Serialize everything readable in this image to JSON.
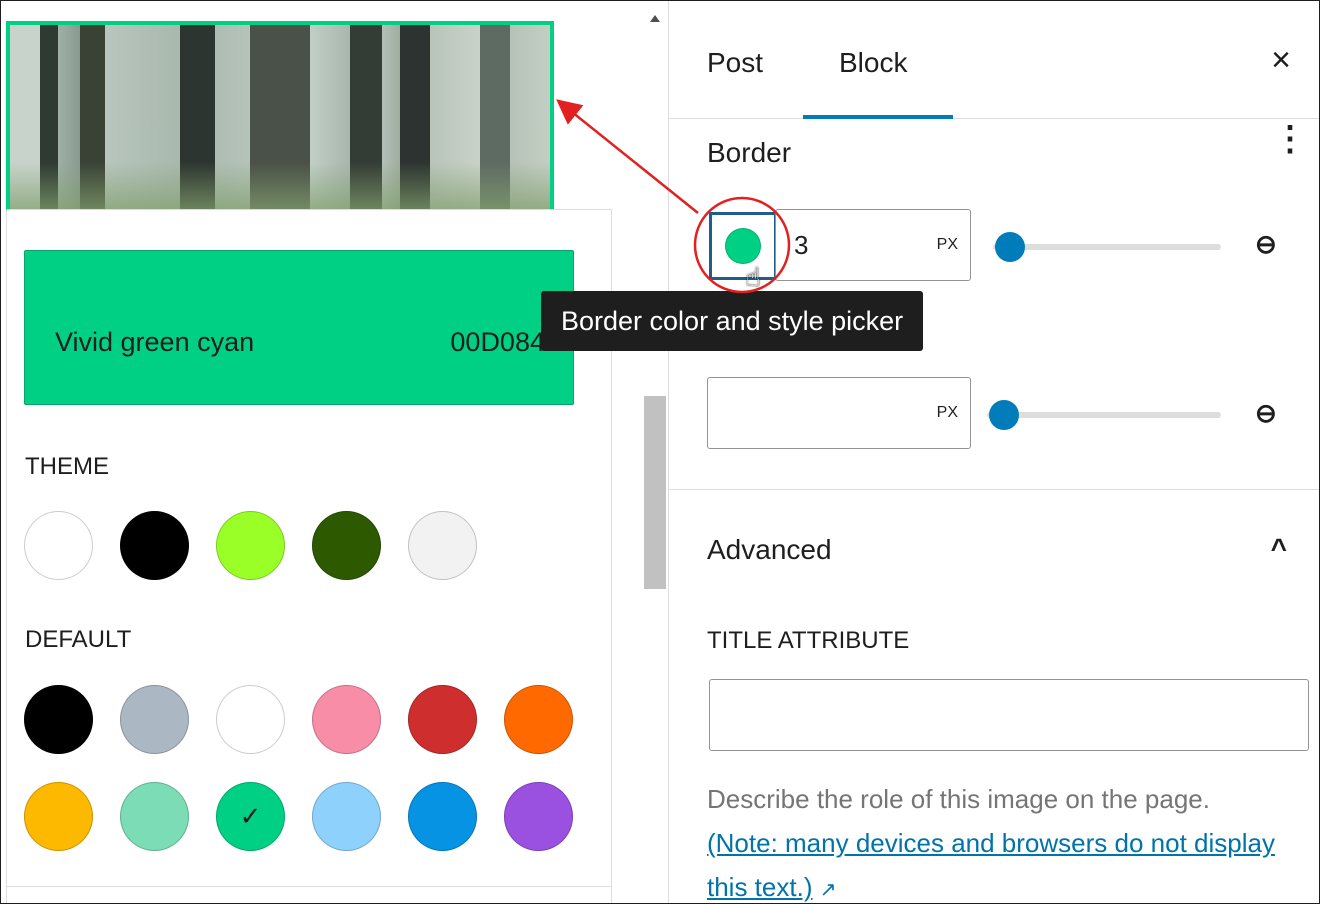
{
  "colors": {
    "accent": "#007cba",
    "selected_border": "#00d084",
    "annotation": "#e32020",
    "help_text": "#757575",
    "link": "#0073aa"
  },
  "color_picker": {
    "selected_name": "Vivid green cyan",
    "selected_hex": "00D084",
    "theme_label": "THEME",
    "default_label": "DEFAULT",
    "theme_swatches": [
      "#ffffff",
      "#000000",
      "#9aff27",
      "#2d5a00",
      "#f2f2f2"
    ],
    "default_swatches_row1": [
      "#000000",
      "#abb8c3",
      "#ffffff",
      "#f78da7",
      "#cf2e2e",
      "#ff6900"
    ],
    "default_swatches_row2": [
      "#fcb900",
      "#7bdcb5",
      "#00d084",
      "#8ed1fc",
      "#0693e3",
      "#9b51e0"
    ],
    "checkmark": "✓"
  },
  "sidebar": {
    "tabs": {
      "post": "Post",
      "block": "Block"
    },
    "close_icon": "×",
    "border": {
      "title": "Border",
      "menu_icon": "⋮",
      "width_value": "3",
      "unit": "PX",
      "radius_value": "",
      "radius_unit": "PX",
      "link_icon": "⊖"
    },
    "tooltip": "Border color and style picker",
    "advanced": {
      "title": "Advanced",
      "chevron": "^",
      "title_attribute_label": "TITLE ATTRIBUTE",
      "title_attribute_value": "",
      "help_text": "Describe the role of this image on the page.",
      "help_link": "(Note: many devices and browsers do not display this text.)",
      "external_icon": "↗"
    }
  }
}
